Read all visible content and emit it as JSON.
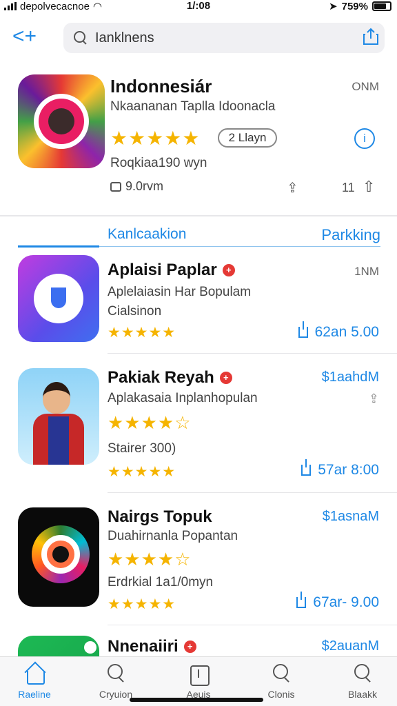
{
  "status": {
    "carrier": "depolvecacnoe",
    "time": "1/:08",
    "battery": "759%"
  },
  "search": {
    "value": "Ianklnens",
    "back_glyph": "<+"
  },
  "featured": {
    "title": "Indonnesiár",
    "size": "ONM",
    "subtitle": "Nkaananan Taplla Idoonacla",
    "rating_stars": "★★★★★",
    "rating_pill": "2 Llayn",
    "reviews": "Roqkiaa190 wyn",
    "comments": "9.0rvm",
    "share_count": "11"
  },
  "section": {
    "tab_left": "Kanlcaakion",
    "tab_right": "Parkking"
  },
  "apps": [
    {
      "title": "Aplaisi Paplar",
      "price": "1NM",
      "line1": "Aplelaiasin Har Bopulam",
      "line2": "Cialsinon",
      "stars": "★★★★★",
      "action_price": "62an 5.00"
    },
    {
      "title": "Pakiak Reyah",
      "price": "$1aahdM",
      "line1": "Aplakasaia Inplanhopulan",
      "line2": "Stairer 300)",
      "stars_big": "★★★★☆",
      "stars": "★★★★★",
      "action_price": "57ar 8:00"
    },
    {
      "title": "Nairgs Topuk",
      "price": "$1asnaM",
      "line1": "Duahirnanla Popantan",
      "line2": "Erdrkial 1a1/0myn",
      "stars_big": "★★★★☆",
      "stars": "★★★★★",
      "action_price": "67ar- 9.00"
    },
    {
      "title": "Nnenaiiri",
      "price": "$2auanM"
    }
  ],
  "tabbar": [
    {
      "label": "Raeline",
      "icon": "home-icon"
    },
    {
      "label": "Cryuion",
      "icon": "search-icon"
    },
    {
      "label": "Aeuis",
      "icon": "apps-icon"
    },
    {
      "label": "Clonis",
      "icon": "search-icon"
    },
    {
      "label": "Blaakk",
      "icon": "search-icon"
    }
  ],
  "colors": {
    "accent": "#1e88e5",
    "star": "#f5b400",
    "badge": "#e53935"
  }
}
